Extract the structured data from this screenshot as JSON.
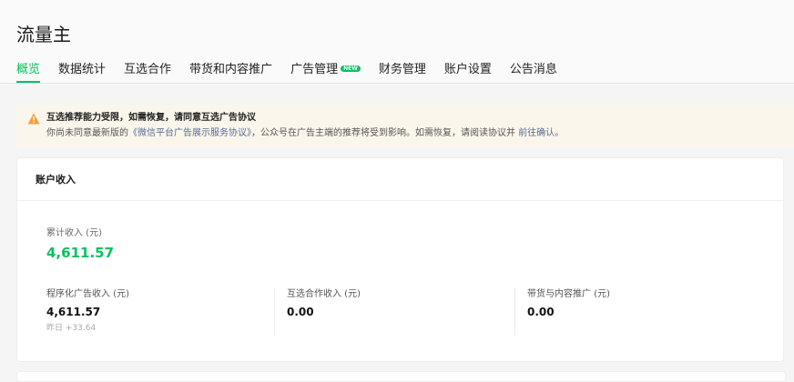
{
  "app": {
    "title": "流量主"
  },
  "tabs": [
    {
      "label": "概览",
      "active": true
    },
    {
      "label": "数据统计"
    },
    {
      "label": "互选合作"
    },
    {
      "label": "带货和内容推广"
    },
    {
      "label": "广告管理",
      "badge": "NEW"
    },
    {
      "label": "财务管理"
    },
    {
      "label": "账户设置"
    },
    {
      "label": "公告消息"
    }
  ],
  "notice": {
    "icon": "warning-icon",
    "title": "互选推荐能力受限，如需恢复，请同意互选广告协议",
    "desc_prefix": "你尚未同意最新版的",
    "agreement_link": "《微信平台广告展示服务协议》",
    "desc_middle": "，公众号在广告主端的推荐将受到影响。如需恢复，请阅读协议并",
    "confirm_link": "前往确认",
    "desc_suffix": "。"
  },
  "income": {
    "card_title": "账户收入",
    "total_label": "累计收入 (元)",
    "total_value": "4,611.57",
    "stats": [
      {
        "label": "程序化广告收入 (元)",
        "value": "4,611.57",
        "sub": "昨日 +33.64"
      },
      {
        "label": "互选合作收入 (元)",
        "value": "0.00"
      },
      {
        "label": "带货与内容推广 (元)",
        "value": "0.00"
      }
    ]
  },
  "colors": {
    "accent": "#07c160",
    "link": "#576b95",
    "warning": "#fa9d3b",
    "notice_bg": "#fbf6ec"
  }
}
